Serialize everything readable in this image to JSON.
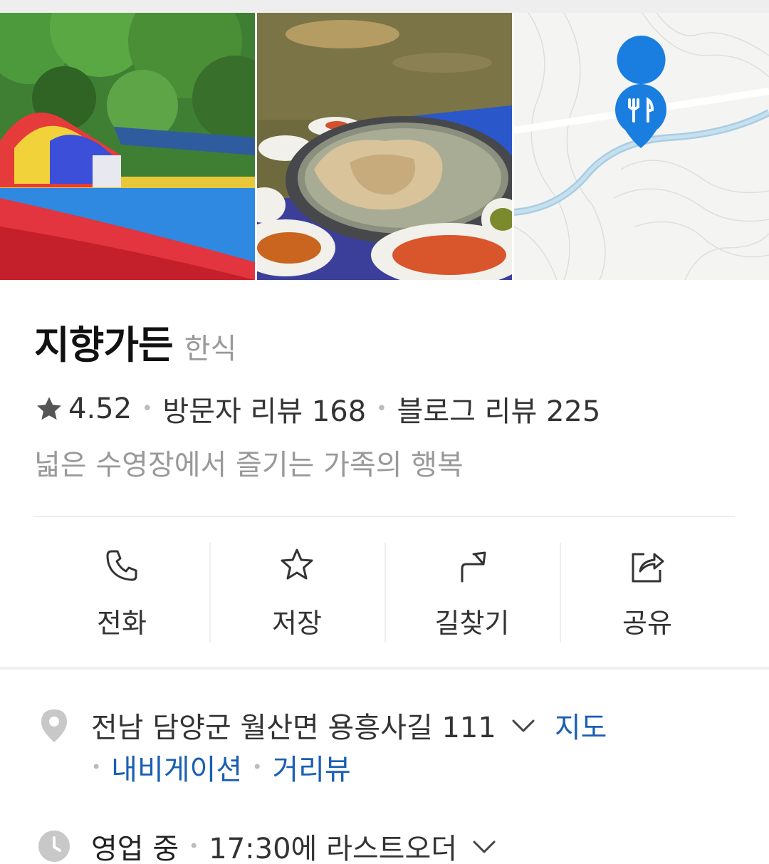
{
  "place": {
    "name": "지향가든",
    "category": "한식",
    "rating": "4.52",
    "visitor_reviews": "방문자 리뷰 168",
    "blog_reviews": "블로그 리뷰 225",
    "description": "넓은 수영장에서 즐기는 가족의 행복"
  },
  "actions": [
    {
      "label": "전화",
      "icon": "phone-icon"
    },
    {
      "label": "저장",
      "icon": "star-outline-icon"
    },
    {
      "label": "길찾기",
      "icon": "directions-icon"
    },
    {
      "label": "공유",
      "icon": "share-icon"
    }
  ],
  "address": {
    "text": "전남 담양군 월산면 용흥사길 111",
    "map_link": "지도",
    "navigation_link": "내비게이션",
    "street_view_link": "거리뷰"
  },
  "hours": {
    "status": "영업 중",
    "detail": "17:30에 라스트오더"
  },
  "photos": [
    "pool-photo",
    "food-photo",
    "map-thumbnail"
  ],
  "colors": {
    "link": "#1a5fb4",
    "map_pin": "#1a7de0",
    "muted_text": "#999999"
  }
}
